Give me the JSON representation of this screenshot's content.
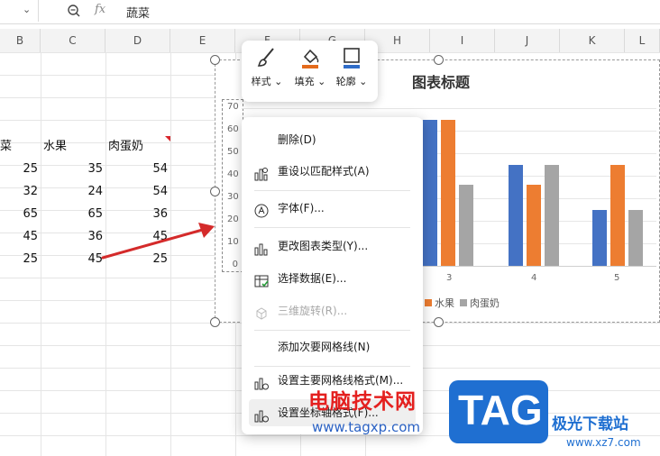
{
  "formula_bar": {
    "formula_text": "蔬菜",
    "fx_label": "fx",
    "dropdown_icon": "chevron-down-icon",
    "zoom_icon": "zoom-icon"
  },
  "columns": [
    "B",
    "C",
    "D",
    "E",
    "F",
    "G",
    "H",
    "I",
    "J",
    "K",
    "L"
  ],
  "sheet": {
    "headers": [
      "菜",
      "水果",
      "肉蛋奶"
    ],
    "rows": [
      [
        "25",
        "35",
        "54"
      ],
      [
        "32",
        "24",
        "54"
      ],
      [
        "65",
        "65",
        "36"
      ],
      [
        "45",
        "36",
        "45"
      ],
      [
        "25",
        "45",
        "25"
      ]
    ]
  },
  "mini_toolbar": {
    "style_label": "样式",
    "fill_label": "填充",
    "outline_label": "轮廓"
  },
  "context_menu": {
    "items": [
      {
        "label": "删除(D)",
        "icon": "",
        "disabled": false
      },
      {
        "label": "重设以匹配样式(A)",
        "icon": "reset-style-icon",
        "disabled": false
      },
      {
        "label": "字体(F)...",
        "icon": "font-icon",
        "disabled": false
      },
      {
        "label": "更改图表类型(Y)...",
        "icon": "chart-type-icon",
        "disabled": false
      },
      {
        "label": "选择数据(E)...",
        "icon": "select-data-icon",
        "disabled": false
      },
      {
        "label": "三维旋转(R)...",
        "icon": "rotate-3d-icon",
        "disabled": true
      },
      {
        "label": "添加次要网格线(N)",
        "icon": "",
        "disabled": false
      },
      {
        "label": "设置主要网格线格式(M)...",
        "icon": "gridline-format-icon",
        "disabled": false
      },
      {
        "label": "设置坐标轴格式(F)...",
        "icon": "axis-format-icon",
        "disabled": false
      }
    ]
  },
  "chart_data": {
    "type": "bar",
    "title": "图表标题",
    "yticks": [
      "70",
      "60",
      "50",
      "40",
      "30",
      "20",
      "10",
      "0"
    ],
    "ylim": [
      0,
      70
    ],
    "categories": [
      "3",
      "4",
      "5"
    ],
    "series": [
      {
        "name": "",
        "color": "#4472c4",
        "values": [
          65,
          45,
          25
        ]
      },
      {
        "name": "水果",
        "color": "#ed7d31",
        "values": [
          65,
          36,
          45
        ]
      },
      {
        "name": "肉蛋奶",
        "color": "#a5a5a5",
        "values": [
          36,
          45,
          25
        ]
      }
    ],
    "legend_position": "bottom",
    "grid": true
  },
  "watermarks": {
    "site_name": "电脑技术网",
    "site_url": "www.tagxp.com",
    "tag_text": "TAG",
    "brand_text": "极光下载站",
    "brand_url": "www.xz7.com"
  }
}
